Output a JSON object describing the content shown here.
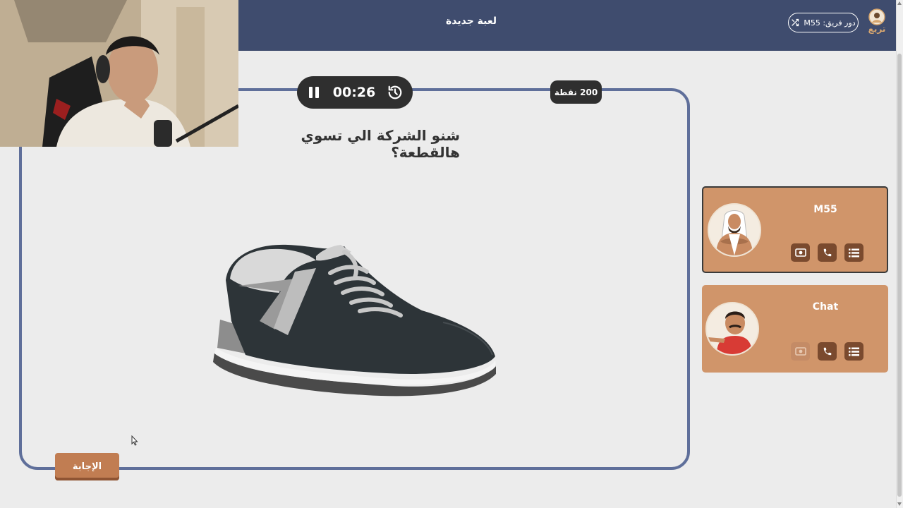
{
  "header": {
    "title": "لعبة جديدة",
    "turn_label": "دور فريق: M55",
    "logo_text": "تريع"
  },
  "game": {
    "timer": "00:26",
    "points": "200 نقطة",
    "question": "شنو الشركة الي تسوي هالقطعة؟",
    "answer_button": "الإجابة"
  },
  "teams": [
    {
      "name": "M55",
      "active": true,
      "tools": [
        "double-points-icon",
        "phone-icon",
        "list-icon"
      ]
    },
    {
      "name": "Chat",
      "active": false,
      "tools": [
        "double-points-icon",
        "phone-icon",
        "list-icon"
      ]
    }
  ],
  "colors": {
    "header_bg": "#3f4c6e",
    "card_border": "#5f6f9a",
    "team_bg": "#d0956a",
    "tool_bg": "#7a4a2e",
    "answer_bg": "#c17d52",
    "dark_pill": "#2f2f2f"
  }
}
